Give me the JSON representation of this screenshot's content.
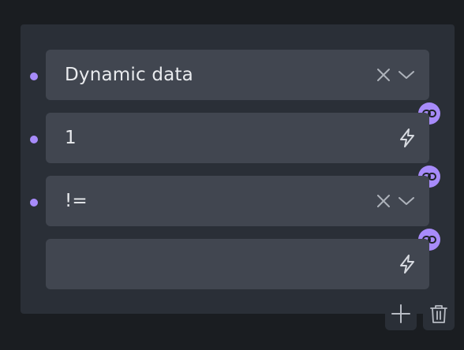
{
  "conditions": {
    "row1": {
      "value": "Dynamic data",
      "icons": [
        "clear-icon",
        "chevron-down-icon"
      ]
    },
    "row2": {
      "value": "1",
      "icons": [
        "lightning-icon"
      ]
    },
    "row3": {
      "value": "!=",
      "icons": [
        "clear-icon",
        "chevron-down-icon"
      ]
    },
    "row4": {
      "value": "",
      "icons": [
        "lightning-icon"
      ]
    }
  },
  "actions": {
    "add_icon": "plus-icon",
    "delete_icon": "trash-icon"
  },
  "colors": {
    "accent": "#a78bfa",
    "field_bg": "#414650",
    "panel_bg": "#2a2f37",
    "page_bg": "#1a1d21",
    "text": "#e9ebee"
  }
}
